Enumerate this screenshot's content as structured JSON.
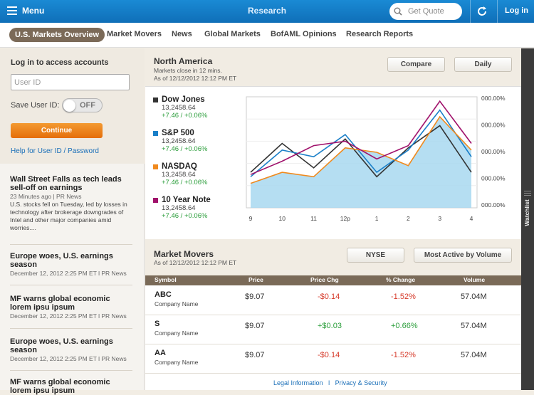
{
  "topbar": {
    "menu_label": "Menu",
    "title": "Research",
    "quote_placeholder": "Get Quote",
    "login_label": "Log in"
  },
  "tabs": [
    "U.S. Markets Overview",
    "Market Movers",
    "News",
    "Global Markets",
    "BofAML Opinions",
    "Research Reports"
  ],
  "login": {
    "title": "Log in to access accounts",
    "userid_placeholder": "User ID",
    "save_label": "Save User ID:",
    "toggle_state": "OFF",
    "continue_label": "Continue",
    "help_link": "Help for User ID / Password"
  },
  "news": [
    {
      "title": "Wall Street Falls as tech leads sell-off on earnings",
      "meta": "23 Minutes ago  |  PR News",
      "body": "U.S. stocks fell on Tuesday, led by losses in technology after brokerage downgrades of Intel and other major companies amid worries...."
    },
    {
      "title": "Europe woes, U.S. earnings season",
      "meta": "December 12, 2012 2:25 PM ET l PR News"
    },
    {
      "title": "MF warns global economic lorem ipsu ipsum",
      "meta": "December 12, 2012 2:25 PM ET l PR News"
    },
    {
      "title": "Europe woes, U.S. earnings season",
      "meta": "December 12, 2012 2:25 PM ET l PR News"
    },
    {
      "title": "MF warns global economic lorem ipsu ipsum",
      "meta": ""
    }
  ],
  "north_america": {
    "title": "North America",
    "close_note": "Markets close in 12 mins.",
    "as_of": "As of 12/12/2012 12:12 PM ET",
    "compare_label": "Compare",
    "daily_label": "Daily"
  },
  "legend": [
    {
      "name": "Dow Jones",
      "value": "13,2458.64",
      "change": "+7.46 / +0.06%",
      "color": "#333333"
    },
    {
      "name": "S&P 500",
      "value": "13,2458.64",
      "change": "+7.46 / +0.06%",
      "color": "#1a7fc8"
    },
    {
      "name": "NASDAQ",
      "value": "13,2458.64",
      "change": "+7.46 / +0.06%",
      "color": "#f08a1e"
    },
    {
      "name": "10  Year Note",
      "value": "13,2458.64",
      "change": "+7.46 / +0.06%",
      "color": "#a0116b"
    }
  ],
  "chart_data": {
    "type": "line",
    "x": [
      "9",
      "10",
      "11",
      "12p",
      "1",
      "2",
      "3",
      "4"
    ],
    "y_tick_labels": [
      "000.00%",
      "000.00%",
      "000.00%",
      "000.00%",
      "000.00%"
    ],
    "series": [
      {
        "name": "Dow Jones",
        "color": "#333333",
        "values": [
          0.32,
          0.58,
          0.36,
          0.62,
          0.28,
          0.54,
          0.74,
          0.32
        ]
      },
      {
        "name": "S&P 500",
        "color": "#1a7fc8",
        "values": [
          0.28,
          0.52,
          0.46,
          0.66,
          0.32,
          0.52,
          0.88,
          0.46
        ]
      },
      {
        "name": "NASDAQ",
        "color": "#f08a1e",
        "values": [
          0.22,
          0.32,
          0.28,
          0.54,
          0.5,
          0.38,
          0.82,
          0.52
        ]
      },
      {
        "name": "10  Year Note",
        "color": "#a0116b",
        "values": [
          0.3,
          0.42,
          0.56,
          0.6,
          0.44,
          0.56,
          0.96,
          0.58
        ]
      }
    ],
    "area_series": "NASDAQ"
  },
  "market_movers": {
    "title": "Market Movers",
    "as_of": "As of 12/12/2012 12:12 PM ET",
    "nyse_label": "NYSE",
    "filter_label": "Most Active by Volume",
    "columns": [
      "Symbol",
      "Price",
      "Price Chg",
      "% Change",
      "Volume"
    ],
    "rows": [
      {
        "symbol": "ABC",
        "name": "Company Name",
        "price": "$9.07",
        "chg": "-$0.14",
        "pct": "-1.52%",
        "volume": "57.04M",
        "dir": "neg"
      },
      {
        "symbol": "S",
        "name": "Company Name",
        "price": "$9.07",
        "chg": "+$0.03",
        "pct": "+0.66%",
        "volume": "57.04M",
        "dir": "pos"
      },
      {
        "symbol": "AA",
        "name": "Company Name",
        "price": "$9.07",
        "chg": "-$0.14",
        "pct": "-1.52%",
        "volume": "57.04M",
        "dir": "neg"
      }
    ]
  },
  "footer": {
    "legal": "Legal Information",
    "sep": "l",
    "privacy": "Privacy & Security"
  },
  "watchlist_label": "Watchlist"
}
